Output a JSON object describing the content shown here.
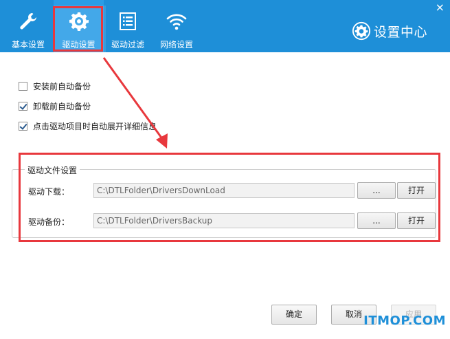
{
  "window": {
    "title": "设置中心",
    "close_glyph": "×",
    "accent_color": "#1e8fd8",
    "highlight_color": "#e8383d"
  },
  "tabs": [
    {
      "label": "基本设置",
      "icon": "wrench-icon"
    },
    {
      "label": "驱动设置",
      "icon": "gear-icon",
      "active": true
    },
    {
      "label": "驱动过滤",
      "icon": "list-icon"
    },
    {
      "label": "网络设置",
      "icon": "wifi-icon"
    }
  ],
  "options": [
    {
      "label": "安装前自动备份",
      "checked": false
    },
    {
      "label": "卸载前自动备份",
      "checked": true
    },
    {
      "label": "点击驱动项目时自动展开详细信息",
      "checked": true
    }
  ],
  "driver_files": {
    "group_title": "驱动文件设置",
    "download": {
      "label": "驱动下载：",
      "path": "C:\\DTLFolder\\DriversDownLoad",
      "browse": "...",
      "open": "打开"
    },
    "backup": {
      "label": "驱动备份：",
      "path": "C:\\DTLFolder\\DriversBackup",
      "browse": "...",
      "open": "打开"
    }
  },
  "footer": {
    "ok": "确定",
    "cancel": "取消",
    "apply": "应用"
  },
  "watermark": "ITMOP.COM"
}
